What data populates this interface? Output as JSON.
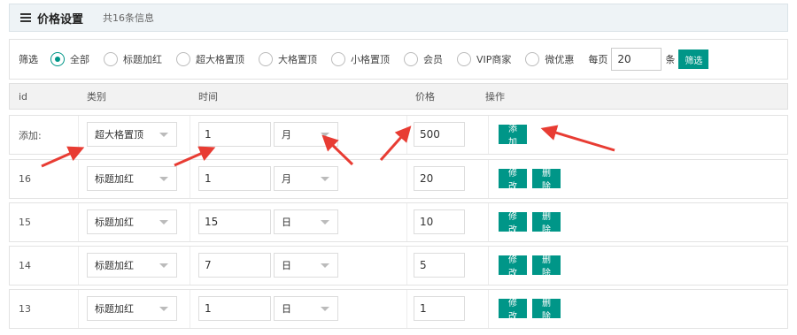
{
  "header": {
    "title": "价格设置",
    "count": "共16条信息"
  },
  "filter": {
    "label": "筛选",
    "options": [
      "全部",
      "标题加红",
      "超大格置顶",
      "大格置顶",
      "小格置顶",
      "会员",
      "VIP商家",
      "微优惠"
    ],
    "selected": "全部",
    "per_page_label": "每页",
    "per_page_value": "20",
    "per_page_unit": "条",
    "submit_label": "筛选"
  },
  "columns": [
    "id",
    "类别",
    "时间",
    "价格",
    "操作"
  ],
  "add_row": {
    "id_label": "添加:",
    "category": "超大格置顶",
    "duration": "1",
    "unit": "月",
    "price": "500",
    "action_label": "添加"
  },
  "rows": [
    {
      "id": "16",
      "category": "标题加红",
      "duration": "1",
      "unit": "月",
      "price": "20"
    },
    {
      "id": "15",
      "category": "标题加红",
      "duration": "15",
      "unit": "日",
      "price": "10"
    },
    {
      "id": "14",
      "category": "标题加红",
      "duration": "7",
      "unit": "日",
      "price": "5"
    },
    {
      "id": "13",
      "category": "标题加红",
      "duration": "1",
      "unit": "日",
      "price": "1"
    }
  ],
  "row_actions": {
    "edit": "修改",
    "delete": "删除"
  },
  "colors": {
    "accent": "#009688",
    "annotation_arrow": "#e83c33"
  }
}
